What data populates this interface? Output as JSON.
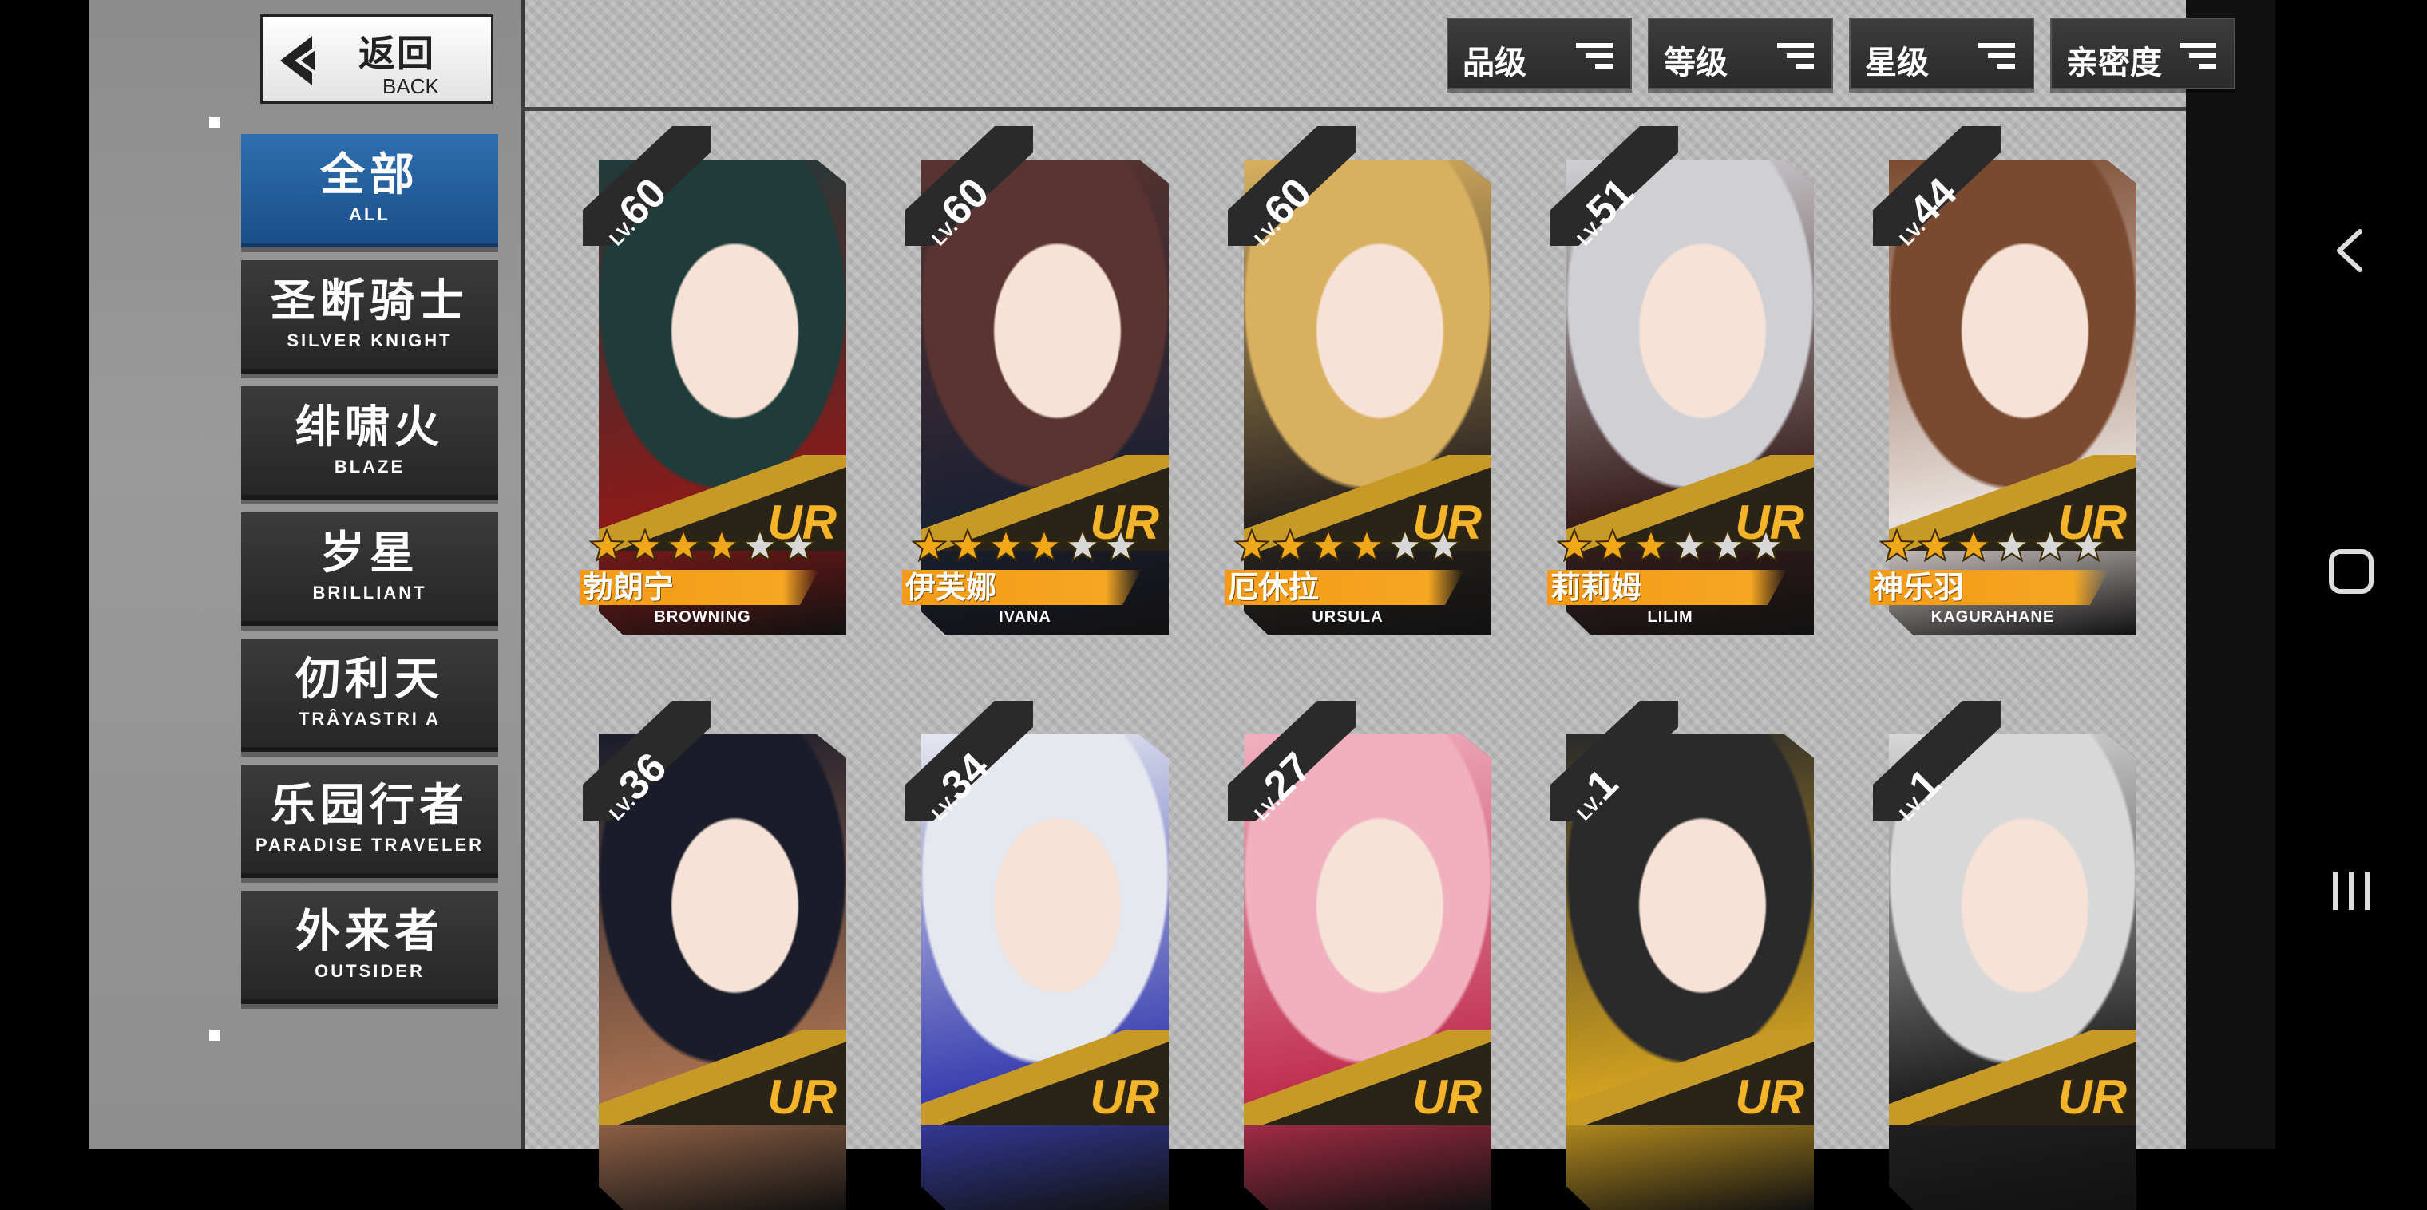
{
  "back_button": {
    "label_cn": "返回",
    "label_en": "BACK",
    "icon": "chevron-left-icon"
  },
  "categories": [
    {
      "cn": "全部",
      "en": "ALL",
      "active": true
    },
    {
      "cn": "圣断骑士",
      "en": "SILVER KNIGHT",
      "active": false
    },
    {
      "cn": "绯啸火",
      "en": "BLAZE",
      "active": false
    },
    {
      "cn": "岁星",
      "en": "BRILLIANT",
      "active": false
    },
    {
      "cn": "仞利天",
      "en": "TRÂYASTRI A",
      "active": false
    },
    {
      "cn": "乐园行者",
      "en": "PARADISE TRAVELER",
      "active": false
    },
    {
      "cn": "外来者",
      "en": "OUTSIDER",
      "active": false
    }
  ],
  "sort_buttons": [
    {
      "label": "品级",
      "icon": "sort-icon"
    },
    {
      "label": "等级",
      "icon": "sort-icon"
    },
    {
      "label": "星级",
      "icon": "sort-icon"
    },
    {
      "label": "亲密度",
      "icon": "sort-icon"
    }
  ],
  "rarity_label": "UR",
  "level_prefix": "LV.",
  "characters": [
    {
      "level": "60",
      "rarity": "UR",
      "stars": 4,
      "max_stars": 6,
      "name_cn": "勃朗宁",
      "name_en": "BROWNING",
      "palette": [
        "#1f3b3a",
        "#8a1a1a"
      ]
    },
    {
      "level": "60",
      "rarity": "UR",
      "stars": 4,
      "max_stars": 6,
      "name_cn": "伊芙娜",
      "name_en": "IVANA",
      "palette": [
        "#5a3430",
        "#1c2033"
      ]
    },
    {
      "level": "60",
      "rarity": "UR",
      "stars": 4,
      "max_stars": 6,
      "name_cn": "厄休拉",
      "name_en": "URSULA",
      "palette": [
        "#d8b060",
        "#2a2420"
      ]
    },
    {
      "level": "51",
      "rarity": "UR",
      "stars": 3,
      "max_stars": 6,
      "name_cn": "莉莉姆",
      "name_en": "LILIM",
      "palette": [
        "#d0d0d4",
        "#3a1e1e"
      ]
    },
    {
      "level": "44",
      "rarity": "UR",
      "stars": 3,
      "max_stars": 6,
      "name_cn": "神乐羽",
      "name_en": "KAGURAHANE",
      "palette": [
        "#7a4a30",
        "#e8e0dc"
      ]
    },
    {
      "level": "36",
      "rarity": "UR",
      "stars": 0,
      "max_stars": 6,
      "name_cn": "",
      "name_en": "",
      "palette": [
        "#1a1c2a",
        "#a77050"
      ]
    },
    {
      "level": "34",
      "rarity": "UR",
      "stars": 0,
      "max_stars": 6,
      "name_cn": "",
      "name_en": "",
      "palette": [
        "#e6e8f0",
        "#3a40b0"
      ]
    },
    {
      "level": "27",
      "rarity": "UR",
      "stars": 0,
      "max_stars": 6,
      "name_cn": "",
      "name_en": "",
      "palette": [
        "#f0b0c0",
        "#c03050"
      ]
    },
    {
      "level": "1",
      "rarity": "UR",
      "stars": 0,
      "max_stars": 6,
      "name_cn": "",
      "name_en": "",
      "palette": [
        "#2a2a2a",
        "#d0a020"
      ]
    },
    {
      "level": "1",
      "rarity": "UR",
      "stars": 0,
      "max_stars": 6,
      "name_cn": "",
      "name_en": "",
      "palette": [
        "#d8d8d8",
        "#222222"
      ]
    }
  ],
  "nav_bar": {
    "back_icon": "back-chevron-icon",
    "home_icon": "home-square-icon",
    "recents_icon": "recents-icon"
  },
  "colors": {
    "accent_blue": "#1b4f8a",
    "name_orange": "#f5a623",
    "ur_gold": "#f3b42a",
    "star_gold": "#f0a818",
    "star_empty": "#d8d8d8"
  }
}
